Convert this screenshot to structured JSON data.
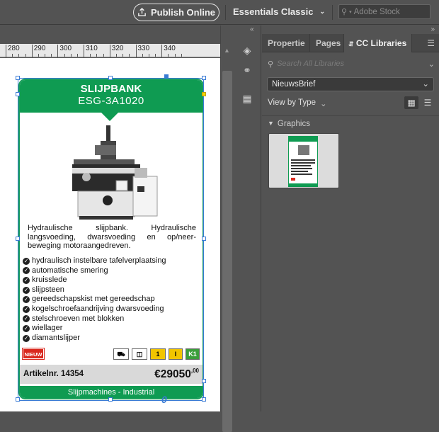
{
  "topbar": {
    "publish_label": "Publish Online",
    "workspace_label": "Essentials Classic",
    "stock_placeholder": "Adobe Stock"
  },
  "ruler": {
    "ticks": [
      "280",
      "290",
      "300",
      "310",
      "320",
      "330",
      "340"
    ]
  },
  "product": {
    "title": "SLIJPBANK",
    "model": "ESG-3A1020",
    "description": "Hydraulische slijpbank. Hydraulische langsvoeding, dwarsvoeding en op/neer-beweging motoraangedreven.",
    "features": [
      "hydraulisch instelbare tafelverplaatsing",
      "automatische smering",
      "kruisslede",
      "slijpsteen",
      "gereedschapskist met gereedschap",
      "kogelschroefaandrijving dwarsvoeding",
      "stelschroeven met blokken",
      "wiellager",
      "diamantslijper"
    ],
    "badge_new": "NIEUW",
    "info_badges": [
      "1",
      "I",
      "K1"
    ],
    "article": "Artikelnr. 14354",
    "price_main": "€29050",
    "price_cents": ",00",
    "category": "Slijpmachines - Industrial",
    "link_glyph": "0"
  },
  "panel": {
    "tabs": [
      "Propertie",
      "Pages",
      "CC Libraries"
    ],
    "active_tab": "CC Libraries",
    "search_placeholder": "Search All Libraries",
    "library": "NieuwsBrief",
    "view_by": "View by Type",
    "section": "Graphics"
  },
  "colors": {
    "accent_green": "#0f9b52",
    "selection_blue": "#3a7bd5",
    "new_red": "#d9281e"
  }
}
